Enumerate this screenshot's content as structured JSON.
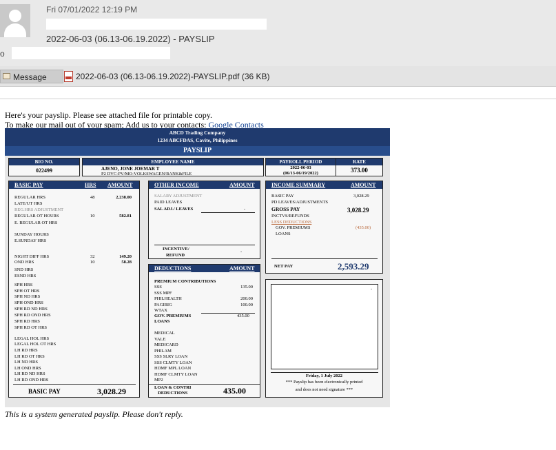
{
  "email": {
    "datetime": "Fri 07/01/2022 12:19 PM",
    "subject": "2022-06-03 (06.13-06.19.2022) - PAYSLIP",
    "to_label": "o",
    "message_tab": "Message",
    "attachment": "2022-06-03 (06.13-06.19.2022)-PAYSLIP.pdf (36 KB)",
    "body_line1": "Here's your payslip. Please see attached file for printable copy.",
    "body_line2": "To make our mail out of your spam; Add us to your contacts:",
    "contacts_link": "Google Contacts",
    "footer": "This is a system generated payslip. Please don't reply."
  },
  "payslip": {
    "company": "ABCD Trading Company",
    "address": "1234 ABCFDAS, Cavite, Philippines",
    "title": "PAYSLIP",
    "bio_no_label": "BIO NO.",
    "bio_no": "022499",
    "employee_name_label": "EMPLOYEE NAME",
    "employee_name": "AJENO, JONE JOEMAR T",
    "employee_info": "P2 DVC-PV/MO-VOLKSWAGEN/RANK&FILE",
    "period_label": "PAYROLL PERIOD",
    "period_date": "2022-06-03",
    "period_range": "(06/13-06/19/2022)",
    "rate_label": "RATE",
    "rate": "373.00",
    "basic": {
      "header": "BASIC PAY",
      "hrs_header": "HRS",
      "amount_header": "AMOUNT",
      "rows": [
        {
          "label": "REGULAR HRS",
          "hrs": "48",
          "amt": "2,238.00"
        },
        {
          "label": "LATE/UT HRS",
          "hrs": "",
          "amt": ""
        },
        {
          "label": "REG.HRS ADJUSTMENT",
          "hrs": "",
          "amt": ""
        },
        {
          "label": "REGULAR OT HOURS",
          "hrs": "10",
          "amt": "582.81"
        },
        {
          "label": "E. REGULAR OT HRS",
          "hrs": "",
          "amt": ""
        },
        {
          "label": "SUNDAY HOURS",
          "hrs": "",
          "amt": ""
        },
        {
          "label": "E.SUNDAY HRS",
          "hrs": "",
          "amt": ""
        },
        {
          "label": "NIGHT DIFF HRS",
          "hrs": "32",
          "amt": "149.20"
        },
        {
          "label": "OND HRS",
          "hrs": "10",
          "amt": "58.28"
        },
        {
          "label": "SND HRS",
          "hrs": "",
          "amt": ""
        },
        {
          "label": "ESND HRS",
          "hrs": "",
          "amt": ""
        },
        {
          "label": "SPH HRS",
          "hrs": "",
          "amt": ""
        },
        {
          "label": "SPH OT HRS",
          "hrs": "",
          "amt": ""
        },
        {
          "label": "SPH ND HRS",
          "hrs": "",
          "amt": ""
        },
        {
          "label": "SPH OND HRS",
          "hrs": "",
          "amt": ""
        },
        {
          "label": "SPH RD ND HRS",
          "hrs": "",
          "amt": ""
        },
        {
          "label": "SPH RD OND HRS",
          "hrs": "",
          "amt": ""
        },
        {
          "label": "SPH RD HRS",
          "hrs": "",
          "amt": ""
        },
        {
          "label": "SPH RD OT HRS",
          "hrs": "",
          "amt": ""
        },
        {
          "label": "LEGAL HOL HRS",
          "hrs": "",
          "amt": ""
        },
        {
          "label": "LEGAL HOL OT HRS",
          "hrs": "",
          "amt": ""
        },
        {
          "label": "LH RD HRS",
          "hrs": "",
          "amt": ""
        },
        {
          "label": "LH RD OT HRS",
          "hrs": "",
          "amt": ""
        },
        {
          "label": "LH ND HRS",
          "hrs": "",
          "amt": ""
        },
        {
          "label": "LH OND HRS",
          "hrs": "",
          "amt": ""
        },
        {
          "label": "LH RD ND HRS",
          "hrs": "",
          "amt": ""
        },
        {
          "label": "LH RD OND HRS",
          "hrs": "",
          "amt": ""
        }
      ],
      "total_label": "BASIC PAY",
      "total": "3,028.29"
    },
    "other_income": {
      "header": "OTHER INCOME",
      "amount_header": "AMOUNT",
      "salary_adj": "SALARY ADJUSTMENT",
      "paid_leaves": "PAID LEAVES",
      "sal_adj_leaves": "SAL ADJ./ LEAVES",
      "sal_adj_leaves_val": "-",
      "incentive": "INCENTIVE/",
      "refund": "REFUND",
      "incentive_val": "-"
    },
    "deductions": {
      "header": "DEDUCTIONS",
      "amount_header": "AMOUNT",
      "premium_header": "PREMIUM CONTRIBUTIONS",
      "rows": [
        {
          "label": "SSS",
          "amt": "135.00"
        },
        {
          "label": "SSS MPF",
          "amt": ""
        },
        {
          "label": "PHILHEALTH",
          "amt": "200.00"
        },
        {
          "label": "PAGIBIG",
          "amt": "100.00"
        },
        {
          "label": "WTAX",
          "amt": ""
        }
      ],
      "gov_premiums": "GOV. PREMIUMS",
      "gov_premiums_val": "435.00",
      "loans": "LOANS",
      "loan_rows": [
        "MEDICAL",
        "VALE",
        "MEDICARD",
        "PHILAM",
        "SSS SLRY LOAN",
        "SSS CLMTY LOAN",
        "HDMF MPL LOAN",
        "HDMF CLMTY LOAN",
        "MP2"
      ],
      "total_label1": "LOAN & CONTRI",
      "total_label2": "DEDUCTIONS",
      "total": "435.00"
    },
    "summary": {
      "header": "INCOME SUMMARY",
      "amount_header": "AMOUNT",
      "basic_pay": "BASIC PAY",
      "basic_pay_val": "3,028.29",
      "pd_leaves": "PD LEAVES/ADJUSTMENTS",
      "gross_pay": "GROSS PAY",
      "gross_pay_val": "3,028.29",
      "incentives": "INCTVS/REFUNDS",
      "less_deductions": "LESS DEDUCTIONS",
      "gov_premiums": "GOV. PREMIUMS",
      "gov_premiums_val": "(435.00)",
      "loans": "LOANS",
      "net_pay": "NET PAY",
      "net_pay_val": "2,593.29"
    },
    "sign": {
      "dash": "-",
      "date": "Friday, 1 July 2022",
      "note1": "*** Payslip has been electronically printed",
      "note2": "and does not need signature ***"
    }
  }
}
